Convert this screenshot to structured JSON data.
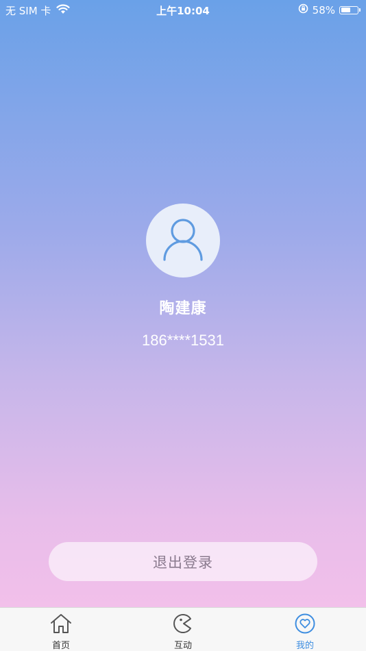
{
  "status_bar": {
    "carrier": "无 SIM 卡",
    "time": "上午10:04",
    "battery_percent": "58%",
    "battery_level": 0.58
  },
  "profile": {
    "name": "陶建康",
    "phone": "186****1531"
  },
  "logout": {
    "label": "退出登录"
  },
  "tab_bar": {
    "tabs": [
      {
        "label": "首页",
        "icon": "home-icon"
      },
      {
        "label": "互动",
        "icon": "interaction-icon"
      },
      {
        "label": "我的",
        "icon": "heart-icon",
        "active": true
      }
    ]
  },
  "colors": {
    "accent": "#3d8de0",
    "gradient_top": "#6aa1e8",
    "gradient_bottom": "#f7c1ea"
  }
}
